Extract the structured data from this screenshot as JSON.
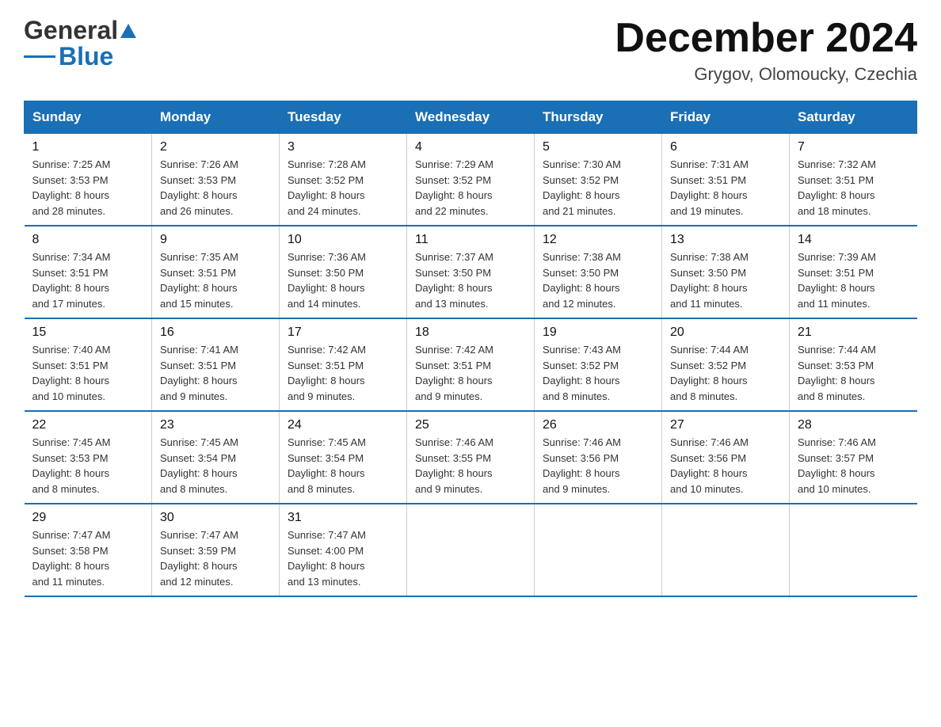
{
  "header": {
    "logo_general": "General",
    "logo_blue": "Blue",
    "month_title": "December 2024",
    "location": "Grygov, Olomoucky, Czechia"
  },
  "days_of_week": [
    "Sunday",
    "Monday",
    "Tuesday",
    "Wednesday",
    "Thursday",
    "Friday",
    "Saturday"
  ],
  "weeks": [
    [
      {
        "day": "1",
        "sunrise": "7:25 AM",
        "sunset": "3:53 PM",
        "daylight": "8 hours and 28 minutes."
      },
      {
        "day": "2",
        "sunrise": "7:26 AM",
        "sunset": "3:53 PM",
        "daylight": "8 hours and 26 minutes."
      },
      {
        "day": "3",
        "sunrise": "7:28 AM",
        "sunset": "3:52 PM",
        "daylight": "8 hours and 24 minutes."
      },
      {
        "day": "4",
        "sunrise": "7:29 AM",
        "sunset": "3:52 PM",
        "daylight": "8 hours and 22 minutes."
      },
      {
        "day": "5",
        "sunrise": "7:30 AM",
        "sunset": "3:52 PM",
        "daylight": "8 hours and 21 minutes."
      },
      {
        "day": "6",
        "sunrise": "7:31 AM",
        "sunset": "3:51 PM",
        "daylight": "8 hours and 19 minutes."
      },
      {
        "day": "7",
        "sunrise": "7:32 AM",
        "sunset": "3:51 PM",
        "daylight": "8 hours and 18 minutes."
      }
    ],
    [
      {
        "day": "8",
        "sunrise": "7:34 AM",
        "sunset": "3:51 PM",
        "daylight": "8 hours and 17 minutes."
      },
      {
        "day": "9",
        "sunrise": "7:35 AM",
        "sunset": "3:51 PM",
        "daylight": "8 hours and 15 minutes."
      },
      {
        "day": "10",
        "sunrise": "7:36 AM",
        "sunset": "3:50 PM",
        "daylight": "8 hours and 14 minutes."
      },
      {
        "day": "11",
        "sunrise": "7:37 AM",
        "sunset": "3:50 PM",
        "daylight": "8 hours and 13 minutes."
      },
      {
        "day": "12",
        "sunrise": "7:38 AM",
        "sunset": "3:50 PM",
        "daylight": "8 hours and 12 minutes."
      },
      {
        "day": "13",
        "sunrise": "7:38 AM",
        "sunset": "3:50 PM",
        "daylight": "8 hours and 11 minutes."
      },
      {
        "day": "14",
        "sunrise": "7:39 AM",
        "sunset": "3:51 PM",
        "daylight": "8 hours and 11 minutes."
      }
    ],
    [
      {
        "day": "15",
        "sunrise": "7:40 AM",
        "sunset": "3:51 PM",
        "daylight": "8 hours and 10 minutes."
      },
      {
        "day": "16",
        "sunrise": "7:41 AM",
        "sunset": "3:51 PM",
        "daylight": "8 hours and 9 minutes."
      },
      {
        "day": "17",
        "sunrise": "7:42 AM",
        "sunset": "3:51 PM",
        "daylight": "8 hours and 9 minutes."
      },
      {
        "day": "18",
        "sunrise": "7:42 AM",
        "sunset": "3:51 PM",
        "daylight": "8 hours and 9 minutes."
      },
      {
        "day": "19",
        "sunrise": "7:43 AM",
        "sunset": "3:52 PM",
        "daylight": "8 hours and 8 minutes."
      },
      {
        "day": "20",
        "sunrise": "7:44 AM",
        "sunset": "3:52 PM",
        "daylight": "8 hours and 8 minutes."
      },
      {
        "day": "21",
        "sunrise": "7:44 AM",
        "sunset": "3:53 PM",
        "daylight": "8 hours and 8 minutes."
      }
    ],
    [
      {
        "day": "22",
        "sunrise": "7:45 AM",
        "sunset": "3:53 PM",
        "daylight": "8 hours and 8 minutes."
      },
      {
        "day": "23",
        "sunrise": "7:45 AM",
        "sunset": "3:54 PM",
        "daylight": "8 hours and 8 minutes."
      },
      {
        "day": "24",
        "sunrise": "7:45 AM",
        "sunset": "3:54 PM",
        "daylight": "8 hours and 8 minutes."
      },
      {
        "day": "25",
        "sunrise": "7:46 AM",
        "sunset": "3:55 PM",
        "daylight": "8 hours and 9 minutes."
      },
      {
        "day": "26",
        "sunrise": "7:46 AM",
        "sunset": "3:56 PM",
        "daylight": "8 hours and 9 minutes."
      },
      {
        "day": "27",
        "sunrise": "7:46 AM",
        "sunset": "3:56 PM",
        "daylight": "8 hours and 10 minutes."
      },
      {
        "day": "28",
        "sunrise": "7:46 AM",
        "sunset": "3:57 PM",
        "daylight": "8 hours and 10 minutes."
      }
    ],
    [
      {
        "day": "29",
        "sunrise": "7:47 AM",
        "sunset": "3:58 PM",
        "daylight": "8 hours and 11 minutes."
      },
      {
        "day": "30",
        "sunrise": "7:47 AM",
        "sunset": "3:59 PM",
        "daylight": "8 hours and 12 minutes."
      },
      {
        "day": "31",
        "sunrise": "7:47 AM",
        "sunset": "4:00 PM",
        "daylight": "8 hours and 13 minutes."
      },
      null,
      null,
      null,
      null
    ]
  ],
  "labels": {
    "sunrise": "Sunrise:",
    "sunset": "Sunset:",
    "daylight": "Daylight:"
  }
}
